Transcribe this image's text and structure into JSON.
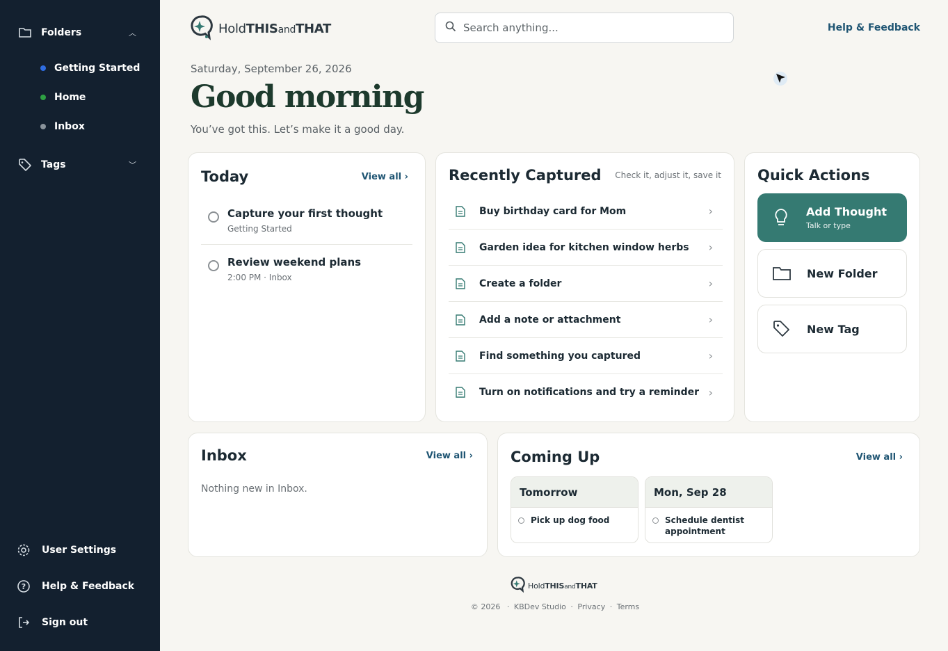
{
  "sidebar": {
    "folders_label": "Folders",
    "folders": [
      {
        "label": "Getting Started",
        "color": "#2f6de1"
      },
      {
        "label": "Home",
        "color": "#2ea043"
      },
      {
        "label": "Inbox",
        "color": "#8a939b"
      }
    ],
    "tags_label": "Tags",
    "bottom": [
      {
        "label": "User Settings",
        "icon": "gear-icon"
      },
      {
        "label": "Help & Feedback",
        "icon": "help-circle-icon"
      },
      {
        "label": "Sign out",
        "icon": "sign-out-icon"
      }
    ]
  },
  "header": {
    "logo": {
      "hold": "Hold",
      "this": "THIS",
      "and": "and",
      "that": "THAT"
    },
    "search_placeholder": "Search anything...",
    "help": "Help & Feedback"
  },
  "hero": {
    "date": "Saturday, September 26, 2026",
    "greeting": "Good morning",
    "subline": "You’ve got this. Let’s make it a good day."
  },
  "today": {
    "title": "Today",
    "view_all": "View all ›",
    "tasks": [
      {
        "title": "Capture your first thought",
        "meta": "Getting Started"
      },
      {
        "title": "Review weekend plans",
        "meta": "2:00 PM · Inbox"
      }
    ]
  },
  "recent": {
    "title": "Recently Captured",
    "hint": "Check it, adjust it, save it",
    "items": [
      "Buy birthday card for Mom",
      "Garden idea for kitchen window herbs",
      "Create a folder",
      "Add a note or attachment",
      "Find something you captured",
      "Turn on notifications and try a reminder"
    ]
  },
  "quick": {
    "title": "Quick Actions",
    "add_thought": "Add Thought",
    "add_thought_sub": "Talk or type",
    "new_folder": "New Folder",
    "new_tag": "New Tag",
    "accent": "#357a72"
  },
  "inbox": {
    "title": "Inbox",
    "view_all": "View all ›",
    "empty": "Nothing new in Inbox."
  },
  "coming": {
    "title": "Coming Up",
    "view_all": "View all ›",
    "days": [
      {
        "label": "Tomorrow",
        "item": "Pick up dog food"
      },
      {
        "label": "Mon, Sep 28",
        "item": "Schedule dentist appointment"
      }
    ]
  },
  "footer": {
    "copyright": "© 2026",
    "studio": "KBDev Studio",
    "privacy": "Privacy",
    "terms": "Terms",
    "sep": "·"
  }
}
